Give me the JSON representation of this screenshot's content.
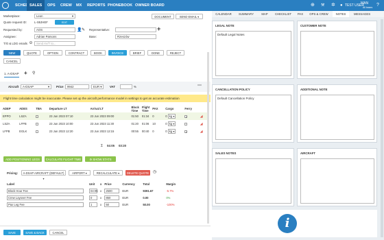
{
  "nav": {
    "items": [
      "SCHED",
      "SALES",
      "OPS",
      "CREW",
      "MX",
      "REPORTS",
      "PHONEBOOK",
      "OWNER BOARD"
    ],
    "active": "SALES",
    "user": "TEST USER",
    "user_sub": "MAN",
    "user_sub2": "All bases"
  },
  "form": {
    "marketplace_label": "Marketplace:",
    "marketplace_value": "Leon",
    "quote_request_label": "Quote request ID:",
    "quote_request_value": "L-S8JHEF",
    "edit_request": "EDIT REQUEST",
    "requested_by_label": "Requested by:",
    "requested_by_value": "AOS",
    "representative_label": "Representative:",
    "assignee_label": "Assignee:",
    "assignee_value": "Adrian Parsons",
    "base_label": "Base:",
    "base_value": "Rzeszów",
    "tlo_label": "T/O & LDG emails",
    "tlo_placeholder": "Send AV/T to...",
    "document_btn": "DOCUMENT",
    "send_email_btn": "SEND EMAIL"
  },
  "status_buttons": [
    "NEW",
    "QUOTE",
    "OPTION",
    "CONTRACT",
    "BOOK",
    "INVOICE",
    "BRIEF",
    "DONE",
    "REJECT",
    "CANCEL"
  ],
  "active_status": "INVOICE",
  "quote_tab": "1. A-DSAP",
  "aircraft": {
    "label": "Aircraft",
    "value": "A-DSAP",
    "price_label": "Price",
    "price_value": "9942",
    "currency": "EUR",
    "vat_label": "VAT",
    "vat_unit": "%"
  },
  "warning": "Flight time calculation might be inaccurate. Please set up the aircraft performance model in settings to get an accurate estimation",
  "legs": {
    "headers": [
      "ADEP",
      "ADES",
      "TBA",
      "Departure LT",
      "Arrival LT",
      "Block Time",
      "Flight Time",
      "PAX",
      "Cargo",
      "Ferry"
    ],
    "rows": [
      {
        "adep": "EPPO",
        "ades": "LSZA",
        "dep_date": "23 Jun 2023",
        "dep_time": "07:10",
        "arr_date": "23 Jun 2023",
        "arr_time": "09:00",
        "block": "01:50",
        "flight": "01:34",
        "pax": "0",
        "cargo": "0",
        "unit": "kg"
      },
      {
        "adep": "LSZA",
        "ades": "LFPB",
        "dep_date": "23 Jun 2023",
        "dep_time": "10:00",
        "arr_date": "23 Jun 2023",
        "arr_time": "11:30",
        "block": "01:20",
        "flight": "01:06",
        "pax": "10",
        "cargo": "0",
        "unit": "kg"
      },
      {
        "adep": "LFPB",
        "ades": "EGLK",
        "dep_date": "23 Jun 2023",
        "dep_time": "12:20",
        "arr_date": "23 Jun 2023",
        "arr_time": "12:15",
        "block": "00:55",
        "flight": "00:40",
        "pax": "0",
        "cargo": "0",
        "unit": "kg"
      }
    ],
    "sum_symbol": "Σ",
    "total_block": "04:05",
    "total_flight": "03:20"
  },
  "leg_actions": [
    "ADD POSITIONING LEGS",
    "CALCULATE FLIGHT TIME",
    "SHOW STATS"
  ],
  "pricing": {
    "label": "Pricing:",
    "aircraft_dropdown": "A-DSAP AIRCRAFT (DEFAULT)",
    "airport_btn": "AIRPORT",
    "recalc_btn": "RECALCULATE",
    "delete_btn": "DELETE QUOTE",
    "headers": [
      "Label",
      "Unit",
      "x",
      "Price",
      "Currency",
      "Total",
      "Margin"
    ],
    "rows": [
      {
        "label": "Block Hour Fee",
        "unit": "04:05",
        "price": "2500",
        "currency": "EUR",
        "total": "9391.67",
        "margin": "-5.7%",
        "margin_color": "#e53935"
      },
      {
        "label": "Crew Layover Fee",
        "unit": "0",
        "price": "850",
        "currency": "EUR",
        "total": "0.00",
        "margin": "0%",
        "margin_color": "#43a047"
      },
      {
        "label": "Pax Leg Fee",
        "unit": "1",
        "price": "50",
        "currency": "EUR",
        "total": "50.00",
        "margin": "-100%",
        "margin_color": "#e53935"
      }
    ]
  },
  "bottom": {
    "save": "SAVE",
    "save_back": "SAVE & BACK",
    "cancel": "CANCEL"
  },
  "right_tabs": [
    "CALENDAR",
    "SUMMARY",
    "MAP",
    "CHECKLIST",
    "PAX",
    "OPS & CREW",
    "NOTES",
    "MESSAGES"
  ],
  "active_right_tab": "NOTES",
  "notes": {
    "legal_note": "LEGAL NOTE",
    "legal_note_text": "Default Legal Notes",
    "customer_note": "CUSTOMER NOTE",
    "cancellation_policy": "CANCELLATION POLICY",
    "cancellation_policy_text": "Default Cancellation Policy",
    "additional_note": "ADDITIONAL NOTE",
    "sales_notes": "SALES NOTES",
    "aircraft": "AIRCRAFT"
  },
  "colors": {
    "nav": "#2a7fc1",
    "accent": "#2a9fd8",
    "warning": "#ffe98a",
    "green": "#8bc34a",
    "red": "#e05a4f"
  }
}
